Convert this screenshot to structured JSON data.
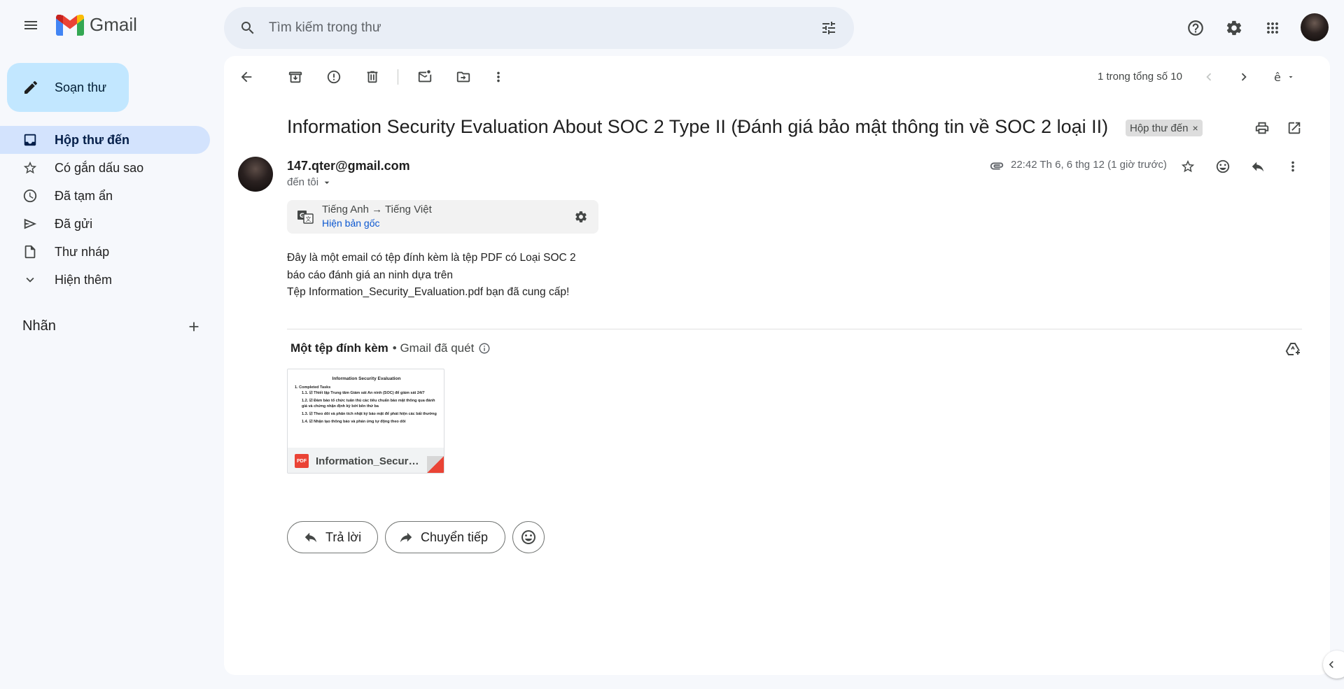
{
  "app": {
    "logo_text": "Gmail"
  },
  "search": {
    "placeholder": "Tìm kiếm trong thư"
  },
  "sidebar": {
    "compose_label": "Soạn thư",
    "items": [
      {
        "label": "Hộp thư đến",
        "icon": "inbox-icon",
        "active": true
      },
      {
        "label": "Có gắn dấu sao",
        "icon": "star-icon"
      },
      {
        "label": "Đã tạm ẩn",
        "icon": "clock-icon"
      },
      {
        "label": "Đã gửi",
        "icon": "send-icon"
      },
      {
        "label": "Thư nháp",
        "icon": "draft-icon"
      },
      {
        "label": "Hiện thêm",
        "icon": "chevron-down-icon"
      }
    ],
    "labels_heading": "Nhãn"
  },
  "toolbar": {
    "page_count": "1 trong tổng số 10"
  },
  "email": {
    "subject": "Information Security Evaluation About SOC 2 Type II (Đánh giá bảo mật thông tin về SOC 2 loại II)",
    "folder_chip": "Hộp thư đến",
    "folder_chip_remove": "×",
    "sender": "147.qter@gmail.com",
    "to": "đến tôi",
    "timestamp": "22:42 Th 6, 6 thg 12 (1 giờ trước)",
    "translation": {
      "languages": "Tiếng Anh → Tiếng Việt",
      "show_original": "Hiện bản gốc"
    },
    "body_lines": [
      "Đây là một email có tệp đính kèm là tệp PDF có Loại SOC 2",
      "báo cáo đánh giá an ninh dựa trên",
      "Tệp Information_Security_Evaluation.pdf bạn đã cung cấp!"
    ],
    "attachments_heading": "Một tệp đính kèm",
    "attachments_scanned": "• Gmail đã quét",
    "attachment": {
      "filename": "Information_Security_Evaluation.pdf",
      "preview": {
        "title": "Information Security Evaluation",
        "lines": [
          "1. Completed Tasks",
          "1.1. ☑ Thiết lập Trung tâm Giám sát An ninh (SOC) để giám sát 24/7",
          "1.2. ☑ Đảm bảo tổ chức tuân thủ các tiêu chuẩn bảo mật thông qua đánh giá và chứng nhận định kỳ bởi bên thứ ba",
          "1.3. ☑ Theo dõi và phân tích nhật ký bảo mật để phát hiện các bất thường",
          "1.4. ☑ Nhận tạo thông báo và phản ứng tự động theo dõi"
        ]
      }
    },
    "actions": {
      "reply": "Trả lời",
      "forward": "Chuyển tiếp"
    }
  },
  "colors": {
    "accent": "#0b57d0",
    "compose_bg": "#c2e7ff",
    "active_nav": "#d3e3fd",
    "page_bg": "#f6f8fc"
  }
}
